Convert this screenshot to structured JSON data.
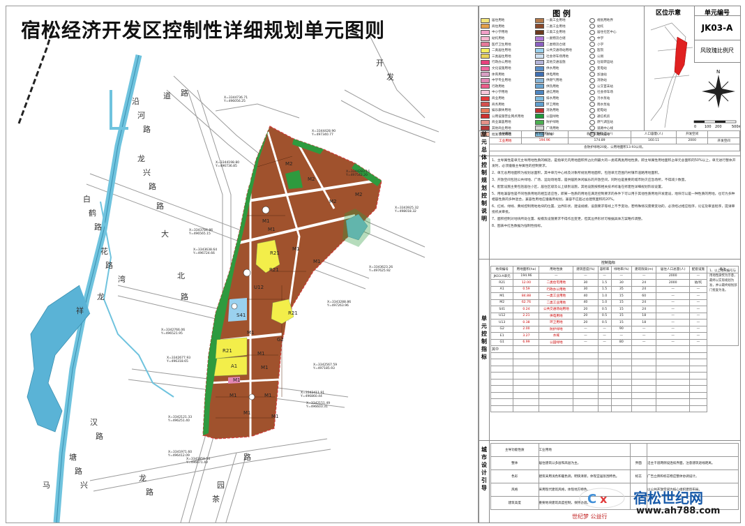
{
  "title": "宿松经济开发区控制性详细规划单元图则",
  "legend": {
    "heading": "图 例",
    "columns": [
      [
        "居住用地",
        "商住用地",
        "中小学用地",
        "幼托用地",
        "医疗卫生用地",
        "二类居住用地",
        "三类居住用地",
        "行政办公用地",
        "文化设施用地",
        "体育用地",
        "中学专业用地",
        "行政用地",
        "中小学用地",
        "商业用地",
        "商务用地",
        "娱乐康体用地",
        "公用设施营业网点用地",
        "商业兼容用地",
        "其他商业用地",
        "批发市场用地"
      ],
      [
        "一类工业用地",
        "二类工业用地",
        "三类工业用地",
        "一类物流仓储",
        "二类物流仓储",
        "公共交通场站用地",
        "社会停车场用地",
        "其他交通设施",
        "供水用地",
        "供电用地",
        "供燃气用地",
        "供热用地",
        "通信用地",
        "排水用地",
        "环卫用地",
        "消防用地",
        "公园绿地",
        "防护绿地",
        "广场用地",
        "水域"
      ],
      [
        "规划用地界",
        "幼托",
        "居住社区中心",
        "中学",
        "小学",
        "医院",
        "公厕",
        "垃圾转运站",
        "变电站",
        "加油站",
        "消防站",
        "公交首末站",
        "社会停车场",
        "污水泵站",
        "雨水泵站",
        "配电站",
        "通信机房",
        "燃气调压站",
        "道路中心线",
        "地块编号"
      ]
    ],
    "colors": [
      "#f3e57a",
      "#e4a04a",
      "#f2a0c8",
      "#f7b7cf",
      "#e57a9a",
      "#f6ef60",
      "#e9d35a",
      "#e8427e",
      "#ef6aa0",
      "#d8a0c4",
      "#e388b5",
      "#ec5d8a",
      "#f7c7da",
      "#e33a3a",
      "#d4504e",
      "#e97b5c",
      "#cf3030",
      "#e6938a",
      "#b33737",
      "#f2b7a3",
      "#b37a4b",
      "#8b4a2a",
      "#6b3a1f",
      "#b07ad8",
      "#8b5fc2",
      "#9ad1ef",
      "#cfe2f3",
      "#b4b4d8",
      "#5a8fc8",
      "#3f6fb3",
      "#89b6d9",
      "#6aa4d1",
      "#4d85c0",
      "#7fbce0",
      "#5f9fcf",
      "#c03030",
      "#1f9a3a",
      "#4caf50",
      "#d8d8d8",
      "#7fc3e6"
    ]
  },
  "location": {
    "heading": "区位示意",
    "scale_labels": [
      "0",
      "100",
      "200",
      "500m"
    ],
    "north_label": "N"
  },
  "unit": {
    "heading": "单元编号",
    "code": "JK03-A",
    "name": "风玫瑰比例尺"
  },
  "summary": {
    "section_label": "单元总体控制",
    "headers": [
      "主导属性",
      "用地面积(ha)",
      "总建筑面积(万m²)",
      "人口容量(人)",
      "开发空间"
    ],
    "row1": [
      "工业用地",
      "194.96",
      "174.89",
      "160.11",
      "2000",
      "开发空间"
    ],
    "note": "含防护绿地20处、公用地面积13.93公顷。"
  },
  "guidance": {
    "section_label": "规划控制说明",
    "items": [
      "1、主导属性是单元主导用地性质的概括，是指单元内用地面积所占比例最大的一类或两类用地性质，即主导属性用地面积占单元总面积的50%以上，单元进行整体开发时，必须遵循主导属性的控制要求。",
      "2、单元总用地面积为规划总面积，其中单元中心线及对象所规划用地面积，包括单元范围内村镇市道路用地面积。",
      "3、开放空间包括公共绿地、广场、运动场地等，是供居民休闲娱乐的开放空间，同时也是重要的城市防灾应急场所，不得减少数量。",
      "4、配套设施主要包括居住小区、居住区级及以上级别设施，其他设施按照相关技术标准在修建性详细规划阶段设置。",
      "5、用地兼容性是不同性质用地的相互适应性，即某一性质的用地在满足控制要求的条件下可以用于其他性质用地开发建设，地块可以是一种性质的用地，也可为多种相容性质的多种混合，兼容性用地应遵循原规划，兼容不应超过总建筑面积的20%。",
      "6、红线、绿线、黄线控制用地地块的位置、边界形状、建设规模、设施要求等线上不予变动，若特殊情况需要变动的，必须经过相应程序，论证及审查程序，提请审批机关审批。",
      "7、面积控制对地块所处位置、规模及设施要求不得作出变更，但其边界形状可根据具体方案略作调整。",
      "8、图表中红色数据为强制性指标。"
    ]
  },
  "indicators": {
    "section_label": "单元控制指标",
    "col_title": "控制指标",
    "headers": [
      "地块编号",
      "用地面积(ha)",
      "用地性质",
      "建筑密度(%)",
      "容积率",
      "绿地率(%)",
      "建筑限高(m)",
      "居住人口总量(人)",
      "配套设施",
      "备注"
    ],
    "rows": [
      [
        "JK03-A单元",
        "194.96",
        "—",
        "—",
        "—",
        "—",
        "—",
        "2000",
        "—",
        "—"
      ],
      [
        "R21",
        "12.00",
        "二类住宅用地",
        "30",
        "1.5",
        "30",
        "24",
        "2000",
        "幼/托",
        "与地块规划建设情况同步"
      ],
      [
        "A1",
        "0.59",
        "行政办公用地",
        "30",
        "1.5",
        "35",
        "24",
        "—",
        "—",
        "—"
      ],
      [
        "M1",
        "84.88",
        "一类工业用地",
        "40",
        "1.0",
        "15",
        "60",
        "—",
        "—",
        "—"
      ],
      [
        "M2",
        "62.76",
        "二类工业用地",
        "40",
        "1.0",
        "15",
        "24",
        "—",
        "—",
        "—"
      ],
      [
        "S41",
        "0.24",
        "公共交通场站用地",
        "20",
        "0.5",
        "15",
        "24",
        "—",
        "—",
        "—"
      ],
      [
        "U12",
        "2.21",
        "供电用地",
        "20",
        "0.5",
        "15",
        "18",
        "—",
        "—",
        "—"
      ],
      [
        "U13",
        "0.38",
        "环卫用地",
        "20",
        "0.5",
        "15",
        "18",
        "—",
        "—",
        "—"
      ],
      [
        "G2",
        "2.00",
        "防护绿地",
        "—",
        "—",
        "90",
        "—",
        "—",
        "—",
        "—"
      ],
      [
        "E1",
        "3.27",
        "水域",
        "—",
        "—",
        "—",
        "—",
        "—",
        "—",
        "—"
      ],
      [
        "G1",
        "6.99",
        "公园绿地",
        "—",
        "—",
        "80",
        "—",
        "—",
        "—",
        "—"
      ]
    ],
    "remark": "1、以上地块编号与用地性质仅为示意，最终以实际规划为准，并以最终规划部门批复为准。",
    "total_label": "其中"
  },
  "urban_design": {
    "section_label": "城市设计引导",
    "rows": [
      [
        "主导功能性质",
        "工业用地",
        "",
        ""
      ],
      [
        "整体",
        "居住建筑以多层和高层为主。",
        "界面",
        "沿主干道两侧设连续界面，注意建筑退线距离。"
      ],
      [
        "色彩",
        "建筑采用浅色和暖色调，明快清新，体现宜居氛围特色。",
        "标志",
        "广告立牌和标志物应整体协调设计。"
      ],
      [
        "风格",
        "采用现代建筑风格，体现地方特色。",
        "",
        "以公共开放空间为核心组织建筑布局。"
      ],
      [
        "建筑高度",
        "重要地块建筑高度控制，保持协调。",
        "",
        ""
      ]
    ]
  },
  "map_labels": {
    "roads": [
      "道",
      "路",
      "沿",
      "河",
      "路",
      "龙",
      "兴",
      "路",
      "白",
      "鹤",
      "路",
      "花",
      "路",
      "湾",
      "塘",
      "路",
      "兴",
      "龙",
      "路",
      "汉",
      "路",
      "马",
      "茶",
      "园",
      "路",
      "龙",
      "祥",
      "路",
      "大",
      "北",
      "路",
      "开",
      "发"
    ],
    "plots": [
      "M2",
      "M2",
      "M2",
      "M2",
      "M1",
      "M1",
      "M1",
      "M1",
      "R21",
      "R21",
      "R21",
      "R21",
      "A1",
      "M1",
      "M1",
      "M1",
      "M1",
      "M1",
      "M1",
      "M1",
      "M1",
      "U12",
      "S41",
      "G2"
    ],
    "coords": [
      "X=3344736.71 Y=496056.25",
      "X=3344428.90 Y=497340.77",
      "X=3344283.16 Y=497542.20",
      "X=3344198.80 Y=496736.85",
      "X=3343925.32 Y=498018.32",
      "X=3343784.86 Y=496565.15",
      "X=3343638.64 Y=496724.66",
      "X=3343623.26 Y=497625.92",
      "X=3343288.86 Y=497263.96",
      "X=3342766.06 Y=496521.95",
      "X=3342677.93 Y=496318.65",
      "X=3342567.59 Y=497185.93",
      "X=3342411.91 Y=496860.44",
      "X=3342151.49 Y=496603.31",
      "X=3342121.33 Y=496251.40",
      "X=3341971.60 Y=496412.09",
      "X=3341859.54 Y=496671.40"
    ]
  },
  "watermark": {
    "main": "宿松世纪网",
    "url": "www.ah788.com",
    "slogan": "世纪梦 公益行"
  }
}
